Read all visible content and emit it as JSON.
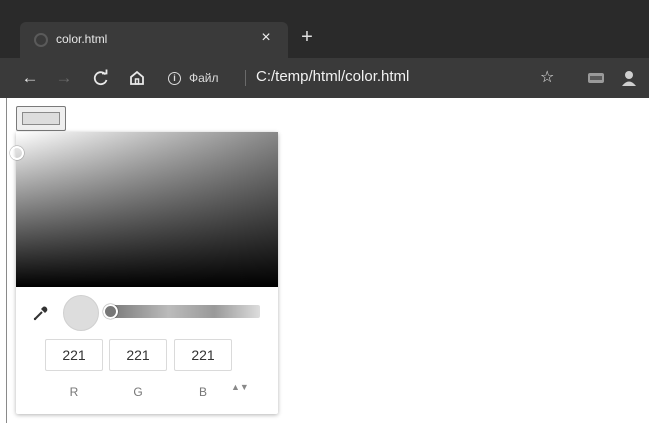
{
  "browser": {
    "tab": {
      "title": "color.html",
      "close_glyph": "×"
    },
    "new_tab_glyph": "+",
    "toolbar": {
      "back_glyph": "←",
      "forward_glyph": "→",
      "reload_glyph": "C",
      "home_glyph": "⌂",
      "site_info_glyph": "i",
      "site_label": "Файл",
      "url": "C:/temp/html/color.html",
      "star_glyph": "☆"
    }
  },
  "page": {
    "color_value": "#dddddd",
    "picker": {
      "r": {
        "label": "R",
        "value": "221"
      },
      "g": {
        "label": "G",
        "value": "221"
      },
      "b": {
        "label": "B",
        "value": "221"
      },
      "format_toggle_glyph": "▲▼"
    }
  }
}
